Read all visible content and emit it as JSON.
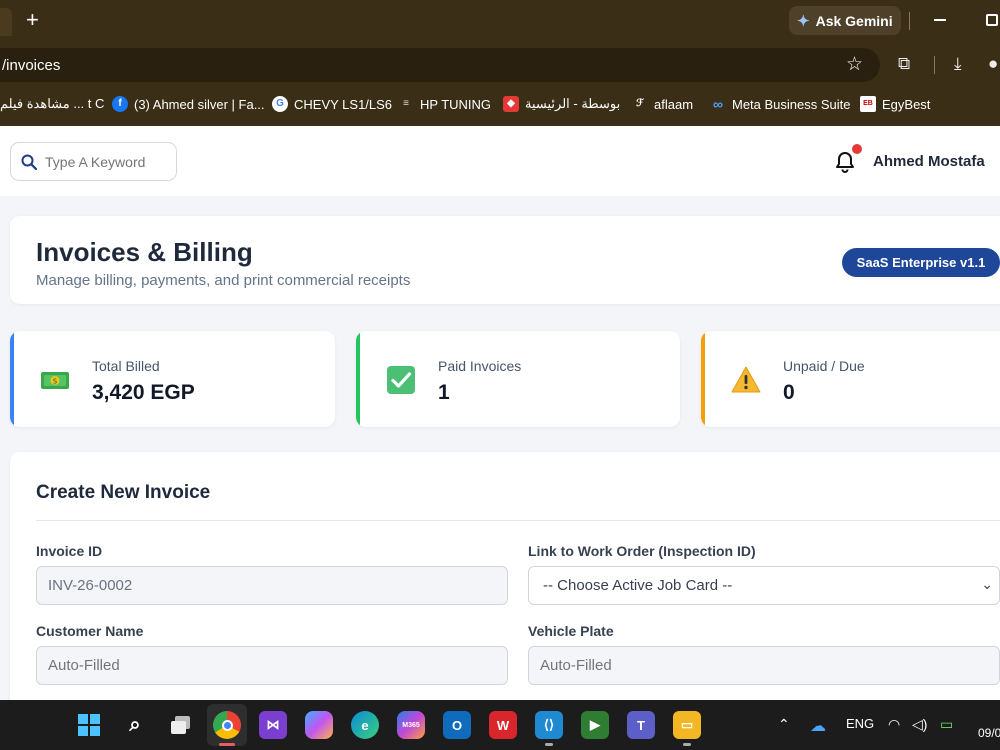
{
  "browser": {
    "new_tab": "+",
    "gemini_label": "Ask Gemini",
    "url": "/invoices",
    "bookmarks": [
      {
        "label": "مشاهدة فيلم ... t C"
      },
      {
        "label": "(3) Ahmed silver | Fa..."
      },
      {
        "label": "CHEVY LS1/LS6"
      },
      {
        "label": "HP TUNING"
      },
      {
        "label": "بوسطة - الرئيسية"
      },
      {
        "label": "aflaam"
      },
      {
        "label": "Meta Business Suite"
      },
      {
        "label": "EgyBest"
      }
    ]
  },
  "topbar": {
    "search_placeholder": "Type A Keyword",
    "user_name": "Ahmed Mostafa"
  },
  "header": {
    "title": "Invoices & Billing",
    "subtitle": "Manage billing, payments, and print commercial receipts",
    "badge": "SaaS Enterprise v1.1"
  },
  "stats": [
    {
      "label": "Total Billed",
      "value": "3,420 EGP",
      "color": "#3b82f6",
      "icon": "money-icon"
    },
    {
      "label": "Paid Invoices",
      "value": "1",
      "color": "#22c55e",
      "icon": "check-icon"
    },
    {
      "label": "Unpaid / Due",
      "value": "0",
      "color": "#f59e0b",
      "icon": "warning-icon"
    }
  ],
  "form": {
    "title": "Create New Invoice",
    "invoice_id_label": "Invoice ID",
    "invoice_id_value": "INV-26-0002",
    "work_order_label": "Link to Work Order (Inspection ID)",
    "work_order_value": "-- Choose Active Job Card --",
    "customer_label": "Customer Name",
    "customer_placeholder": "Auto-Filled",
    "plate_label": "Vehicle Plate",
    "plate_placeholder": "Auto-Filled"
  },
  "taskbar": {
    "language": "ENG",
    "date_partial": "09/0"
  }
}
